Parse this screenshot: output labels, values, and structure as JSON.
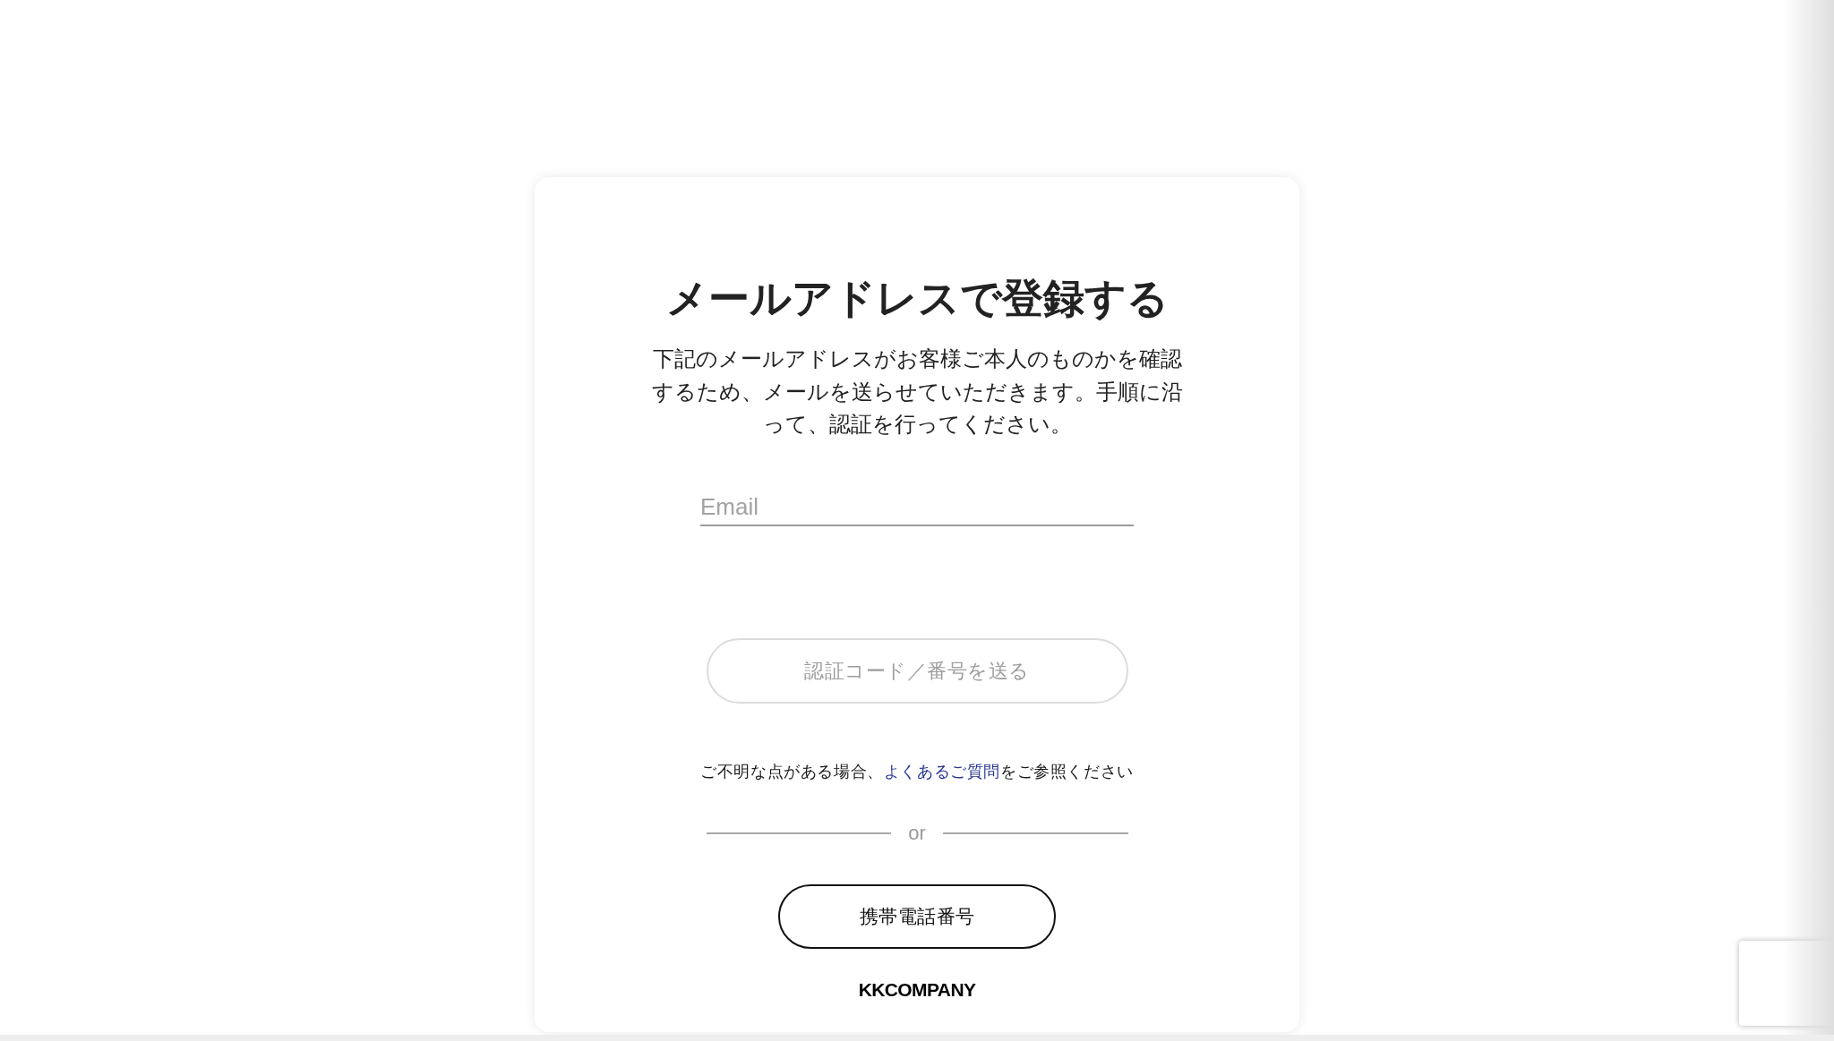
{
  "card": {
    "title": "メールアドレスで登録する",
    "description": "下記のメールアドレスがお客様ご本人のものかを確認するため、メールを送らせていただきます。手順に沿って、認証を行ってください。",
    "email_field": {
      "placeholder": "Email"
    },
    "send_code_button": {
      "label": "認証コード／番号を送る",
      "disabled": true
    },
    "help_text": {
      "before": "ご不明な点がある場合、",
      "link": "よくあるご質問",
      "after": "をご参照ください"
    },
    "divider": {
      "label": "or"
    },
    "phone_button": {
      "label": "携帯電話番号",
      "disabled": false
    },
    "logo": {
      "text": "KKCOMPANY"
    }
  }
}
